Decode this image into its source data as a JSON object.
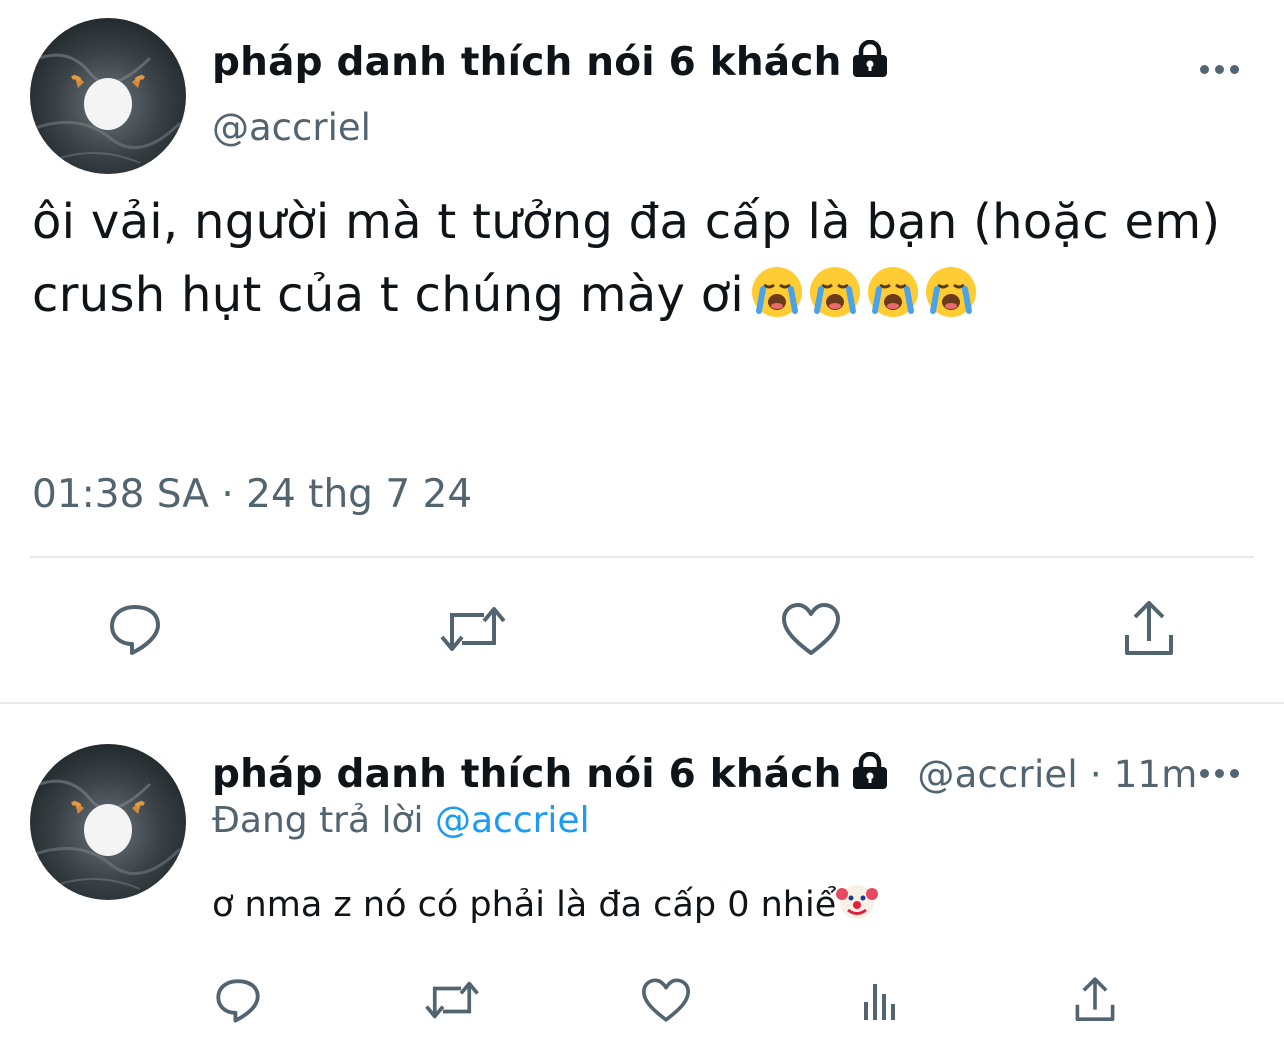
{
  "main_tweet": {
    "display_name": "pháp danh thích nói 6 khách",
    "handle": "@accriel",
    "text_line1": "ôi vải, người mà t tưởng đa cấp là bạn (hoặc em)",
    "text_line2": "crush hụt của t chúng mày ơi",
    "emoji_count": 4,
    "timestamp": "01:38 SA · 24 thg 7 24"
  },
  "reply_tweet": {
    "display_name": "pháp danh thích nói 6 khách",
    "handle": "@accriel",
    "separator": "·",
    "time_ago": "11m",
    "replying_to_label": "Đang trả lời",
    "replying_to_mention": "@accriel",
    "text": "ơ nma z nó có phải là đa cấp 0 nhiể"
  },
  "icons": {
    "lock": "lock-icon",
    "more": "more-icon",
    "reply": "reply-icon",
    "retweet": "retweet-icon",
    "like": "like-icon",
    "share": "share-icon",
    "views": "views-icon",
    "crying_emoji": "loudly-crying-face-icon",
    "clown_emoji": "clown-face-icon"
  },
  "colors": {
    "text_primary": "#0f1419",
    "text_secondary": "#536471",
    "link": "#1d9bf0",
    "divider": "#e6e9eb"
  }
}
